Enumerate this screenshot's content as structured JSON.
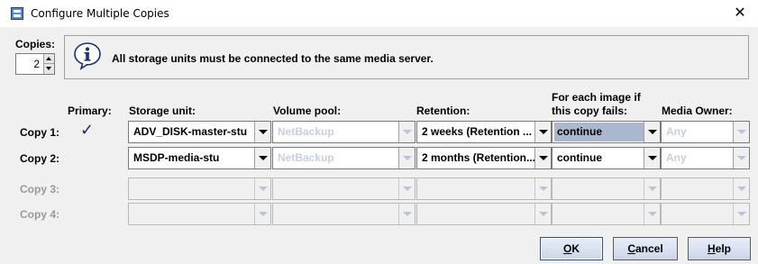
{
  "window": {
    "title": "Configure Multiple Copies",
    "close_symbol": "✕",
    "icon": "app-window-icon"
  },
  "copies": {
    "label": "Copies:",
    "value": "2"
  },
  "info": {
    "icon": "info-icon",
    "message": "All storage units must be connected to the same media server."
  },
  "headers": {
    "primary": "Primary:",
    "storage_unit": "Storage unit:",
    "volume_pool": "Volume pool:",
    "retention": "Retention:",
    "failure_line1": "For each image if",
    "failure_line2": "this copy fails:",
    "media_owner": "Media Owner:"
  },
  "rows": [
    {
      "label": "Copy 1:",
      "enabled": true,
      "primary": true,
      "primary_mark": "✓",
      "storage_unit": "ADV_DISK-master-stu",
      "volume_pool": "NetBackup",
      "retention": "2 weeks (Retention ...",
      "failure_action": "continue",
      "media_owner": "Any"
    },
    {
      "label": "Copy 2:",
      "enabled": true,
      "primary": false,
      "primary_mark": "",
      "storage_unit": "MSDP-media-stu",
      "volume_pool": "NetBackup",
      "retention": "2 months (Retention...",
      "failure_action": "continue",
      "media_owner": "Any"
    },
    {
      "label": "Copy 3:",
      "enabled": false,
      "primary": false,
      "primary_mark": "",
      "storage_unit": "",
      "volume_pool": "",
      "retention": "",
      "failure_action": "",
      "media_owner": ""
    },
    {
      "label": "Copy 4:",
      "enabled": false,
      "primary": false,
      "primary_mark": "",
      "storage_unit": "",
      "volume_pool": "",
      "retention": "",
      "failure_action": "",
      "media_owner": ""
    }
  ],
  "buttons": {
    "ok_mnemonic": "O",
    "ok_rest": "K",
    "cancel_mnemonic": "C",
    "cancel_rest": "ancel",
    "help_mnemonic": "H",
    "help_rest": "elp"
  },
  "colors": {
    "selected_field": "#a9b8cf",
    "disabled_text": "#c6cfe0",
    "checkmark": "#1c2a6e"
  }
}
